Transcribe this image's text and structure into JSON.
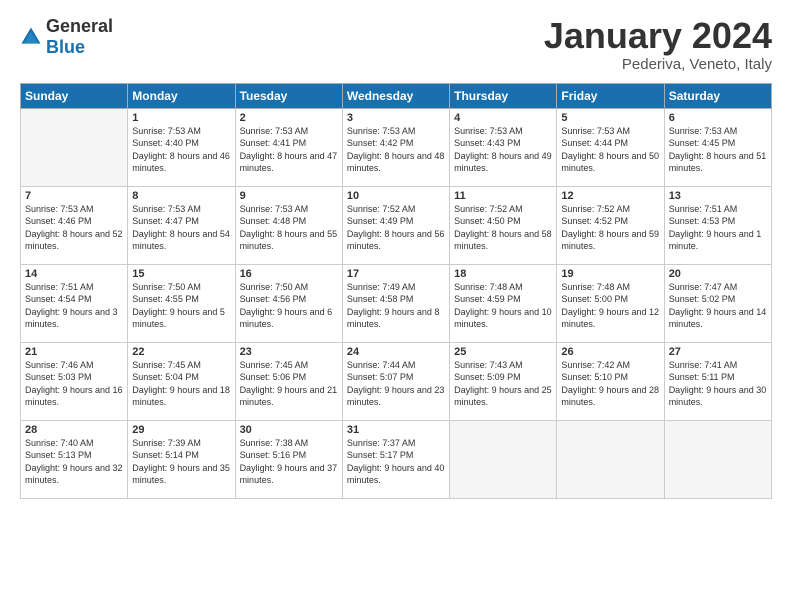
{
  "header": {
    "logo_general": "General",
    "logo_blue": "Blue",
    "title": "January 2024",
    "location": "Pederiva, Veneto, Italy"
  },
  "days_of_week": [
    "Sunday",
    "Monday",
    "Tuesday",
    "Wednesday",
    "Thursday",
    "Friday",
    "Saturday"
  ],
  "weeks": [
    [
      {
        "num": "",
        "empty": true
      },
      {
        "num": "1",
        "sunrise": "7:53 AM",
        "sunset": "4:40 PM",
        "daylight": "8 hours and 46 minutes."
      },
      {
        "num": "2",
        "sunrise": "7:53 AM",
        "sunset": "4:41 PM",
        "daylight": "8 hours and 47 minutes."
      },
      {
        "num": "3",
        "sunrise": "7:53 AM",
        "sunset": "4:42 PM",
        "daylight": "8 hours and 48 minutes."
      },
      {
        "num": "4",
        "sunrise": "7:53 AM",
        "sunset": "4:43 PM",
        "daylight": "8 hours and 49 minutes."
      },
      {
        "num": "5",
        "sunrise": "7:53 AM",
        "sunset": "4:44 PM",
        "daylight": "8 hours and 50 minutes."
      },
      {
        "num": "6",
        "sunrise": "7:53 AM",
        "sunset": "4:45 PM",
        "daylight": "8 hours and 51 minutes."
      }
    ],
    [
      {
        "num": "7",
        "sunrise": "7:53 AM",
        "sunset": "4:46 PM",
        "daylight": "8 hours and 52 minutes."
      },
      {
        "num": "8",
        "sunrise": "7:53 AM",
        "sunset": "4:47 PM",
        "daylight": "8 hours and 54 minutes."
      },
      {
        "num": "9",
        "sunrise": "7:53 AM",
        "sunset": "4:48 PM",
        "daylight": "8 hours and 55 minutes."
      },
      {
        "num": "10",
        "sunrise": "7:52 AM",
        "sunset": "4:49 PM",
        "daylight": "8 hours and 56 minutes."
      },
      {
        "num": "11",
        "sunrise": "7:52 AM",
        "sunset": "4:50 PM",
        "daylight": "8 hours and 58 minutes."
      },
      {
        "num": "12",
        "sunrise": "7:52 AM",
        "sunset": "4:52 PM",
        "daylight": "8 hours and 59 minutes."
      },
      {
        "num": "13",
        "sunrise": "7:51 AM",
        "sunset": "4:53 PM",
        "daylight": "9 hours and 1 minute."
      }
    ],
    [
      {
        "num": "14",
        "sunrise": "7:51 AM",
        "sunset": "4:54 PM",
        "daylight": "9 hours and 3 minutes."
      },
      {
        "num": "15",
        "sunrise": "7:50 AM",
        "sunset": "4:55 PM",
        "daylight": "9 hours and 5 minutes."
      },
      {
        "num": "16",
        "sunrise": "7:50 AM",
        "sunset": "4:56 PM",
        "daylight": "9 hours and 6 minutes."
      },
      {
        "num": "17",
        "sunrise": "7:49 AM",
        "sunset": "4:58 PM",
        "daylight": "9 hours and 8 minutes."
      },
      {
        "num": "18",
        "sunrise": "7:48 AM",
        "sunset": "4:59 PM",
        "daylight": "9 hours and 10 minutes."
      },
      {
        "num": "19",
        "sunrise": "7:48 AM",
        "sunset": "5:00 PM",
        "daylight": "9 hours and 12 minutes."
      },
      {
        "num": "20",
        "sunrise": "7:47 AM",
        "sunset": "5:02 PM",
        "daylight": "9 hours and 14 minutes."
      }
    ],
    [
      {
        "num": "21",
        "sunrise": "7:46 AM",
        "sunset": "5:03 PM",
        "daylight": "9 hours and 16 minutes."
      },
      {
        "num": "22",
        "sunrise": "7:45 AM",
        "sunset": "5:04 PM",
        "daylight": "9 hours and 18 minutes."
      },
      {
        "num": "23",
        "sunrise": "7:45 AM",
        "sunset": "5:06 PM",
        "daylight": "9 hours and 21 minutes."
      },
      {
        "num": "24",
        "sunrise": "7:44 AM",
        "sunset": "5:07 PM",
        "daylight": "9 hours and 23 minutes."
      },
      {
        "num": "25",
        "sunrise": "7:43 AM",
        "sunset": "5:09 PM",
        "daylight": "9 hours and 25 minutes."
      },
      {
        "num": "26",
        "sunrise": "7:42 AM",
        "sunset": "5:10 PM",
        "daylight": "9 hours and 28 minutes."
      },
      {
        "num": "27",
        "sunrise": "7:41 AM",
        "sunset": "5:11 PM",
        "daylight": "9 hours and 30 minutes."
      }
    ],
    [
      {
        "num": "28",
        "sunrise": "7:40 AM",
        "sunset": "5:13 PM",
        "daylight": "9 hours and 32 minutes."
      },
      {
        "num": "29",
        "sunrise": "7:39 AM",
        "sunset": "5:14 PM",
        "daylight": "9 hours and 35 minutes."
      },
      {
        "num": "30",
        "sunrise": "7:38 AM",
        "sunset": "5:16 PM",
        "daylight": "9 hours and 37 minutes."
      },
      {
        "num": "31",
        "sunrise": "7:37 AM",
        "sunset": "5:17 PM",
        "daylight": "9 hours and 40 minutes."
      },
      {
        "num": "",
        "empty": true
      },
      {
        "num": "",
        "empty": true
      },
      {
        "num": "",
        "empty": true
      }
    ]
  ]
}
